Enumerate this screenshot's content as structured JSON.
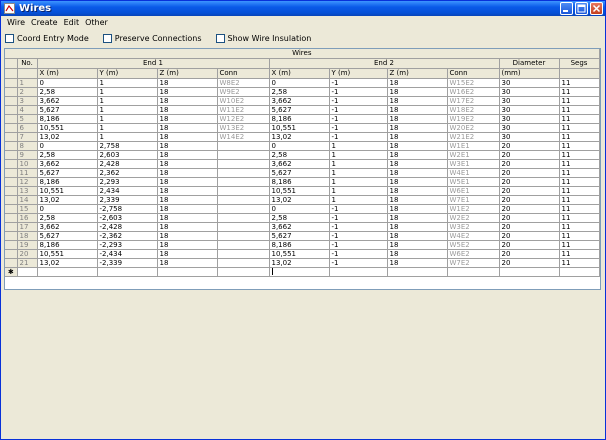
{
  "window": {
    "title": "Wires",
    "accent": "#0a5ae8"
  },
  "menu": [
    {
      "label": "Wire"
    },
    {
      "label": "Create"
    },
    {
      "label": "Edit"
    },
    {
      "label": "Other"
    }
  ],
  "options": [
    {
      "label": "Coord Entry Mode",
      "checked": false
    },
    {
      "label": "Preserve Connections",
      "checked": false
    },
    {
      "label": "Show Wire Insulation",
      "checked": false
    }
  ],
  "grid": {
    "caption": "Wires",
    "group_headers": {
      "no": "No.",
      "end1": "End 1",
      "end2": "End 2",
      "diameter": "Diameter",
      "segs": "Segs"
    },
    "columns": [
      "",
      "X  (m)",
      "Y  (m)",
      "Z  (m)",
      "Conn",
      "X  (m)",
      "Y  (m)",
      "Z  (m)",
      "Conn",
      "(mm)",
      ""
    ],
    "new_row_marker": "✱",
    "rows": [
      {
        "no": "1",
        "x1": "0",
        "y1": "1",
        "z1": "18",
        "c1": "W8E2",
        "x2": "0",
        "y2": "-1",
        "z2": "18",
        "c2": "W15E2",
        "d": "30",
        "s": "11"
      },
      {
        "no": "2",
        "x1": "2,58",
        "y1": "1",
        "z1": "18",
        "c1": "W9E2",
        "x2": "2,58",
        "y2": "-1",
        "z2": "18",
        "c2": "W16E2",
        "d": "30",
        "s": "11"
      },
      {
        "no": "3",
        "x1": "3,662",
        "y1": "1",
        "z1": "18",
        "c1": "W10E2",
        "x2": "3,662",
        "y2": "-1",
        "z2": "18",
        "c2": "W17E2",
        "d": "30",
        "s": "11"
      },
      {
        "no": "4",
        "x1": "5,627",
        "y1": "1",
        "z1": "18",
        "c1": "W11E2",
        "x2": "5,627",
        "y2": "-1",
        "z2": "18",
        "c2": "W18E2",
        "d": "30",
        "s": "11"
      },
      {
        "no": "5",
        "x1": "8,186",
        "y1": "1",
        "z1": "18",
        "c1": "W12E2",
        "x2": "8,186",
        "y2": "-1",
        "z2": "18",
        "c2": "W19E2",
        "d": "30",
        "s": "11"
      },
      {
        "no": "6",
        "x1": "10,551",
        "y1": "1",
        "z1": "18",
        "c1": "W13E2",
        "x2": "10,551",
        "y2": "-1",
        "z2": "18",
        "c2": "W20E2",
        "d": "30",
        "s": "11"
      },
      {
        "no": "7",
        "x1": "13,02",
        "y1": "1",
        "z1": "18",
        "c1": "W14E2",
        "x2": "13,02",
        "y2": "-1",
        "z2": "18",
        "c2": "W21E2",
        "d": "30",
        "s": "11"
      },
      {
        "no": "8",
        "x1": "0",
        "y1": "2,758",
        "z1": "18",
        "c1": "",
        "x2": "0",
        "y2": "1",
        "z2": "18",
        "c2": "W1E1",
        "d": "20",
        "s": "11"
      },
      {
        "no": "9",
        "x1": "2,58",
        "y1": "2,603",
        "z1": "18",
        "c1": "",
        "x2": "2,58",
        "y2": "1",
        "z2": "18",
        "c2": "W2E1",
        "d": "20",
        "s": "11"
      },
      {
        "no": "10",
        "x1": "3,662",
        "y1": "2,428",
        "z1": "18",
        "c1": "",
        "x2": "3,662",
        "y2": "1",
        "z2": "18",
        "c2": "W3E1",
        "d": "20",
        "s": "11"
      },
      {
        "no": "11",
        "x1": "5,627",
        "y1": "2,362",
        "z1": "18",
        "c1": "",
        "x2": "5,627",
        "y2": "1",
        "z2": "18",
        "c2": "W4E1",
        "d": "20",
        "s": "11"
      },
      {
        "no": "12",
        "x1": "8,186",
        "y1": "2,293",
        "z1": "18",
        "c1": "",
        "x2": "8,186",
        "y2": "1",
        "z2": "18",
        "c2": "W5E1",
        "d": "20",
        "s": "11"
      },
      {
        "no": "13",
        "x1": "10,551",
        "y1": "2,434",
        "z1": "18",
        "c1": "",
        "x2": "10,551",
        "y2": "1",
        "z2": "18",
        "c2": "W6E1",
        "d": "20",
        "s": "11"
      },
      {
        "no": "14",
        "x1": "13,02",
        "y1": "2,339",
        "z1": "18",
        "c1": "",
        "x2": "13,02",
        "y2": "1",
        "z2": "18",
        "c2": "W7E1",
        "d": "20",
        "s": "11"
      },
      {
        "no": "15",
        "x1": "0",
        "y1": "-2,758",
        "z1": "18",
        "c1": "",
        "x2": "0",
        "y2": "-1",
        "z2": "18",
        "c2": "W1E2",
        "d": "20",
        "s": "11"
      },
      {
        "no": "16",
        "x1": "2,58",
        "y1": "-2,603",
        "z1": "18",
        "c1": "",
        "x2": "2,58",
        "y2": "-1",
        "z2": "18",
        "c2": "W2E2",
        "d": "20",
        "s": "11"
      },
      {
        "no": "17",
        "x1": "3,662",
        "y1": "-2,428",
        "z1": "18",
        "c1": "",
        "x2": "3,662",
        "y2": "-1",
        "z2": "18",
        "c2": "W3E2",
        "d": "20",
        "s": "11"
      },
      {
        "no": "18",
        "x1": "5,627",
        "y1": "-2,362",
        "z1": "18",
        "c1": "",
        "x2": "5,627",
        "y2": "-1",
        "z2": "18",
        "c2": "W4E2",
        "d": "20",
        "s": "11"
      },
      {
        "no": "19",
        "x1": "8,186",
        "y1": "-2,293",
        "z1": "18",
        "c1": "",
        "x2": "8,186",
        "y2": "-1",
        "z2": "18",
        "c2": "W5E2",
        "d": "20",
        "s": "11"
      },
      {
        "no": "20",
        "x1": "10,551",
        "y1": "-2,434",
        "z1": "18",
        "c1": "",
        "x2": "10,551",
        "y2": "-1",
        "z2": "18",
        "c2": "W6E2",
        "d": "20",
        "s": "11"
      },
      {
        "no": "21",
        "x1": "13,02",
        "y1": "-2,339",
        "z1": "18",
        "c1": "",
        "x2": "13,02",
        "y2": "-1",
        "z2": "18",
        "c2": "W7E2",
        "d": "20",
        "s": "11"
      }
    ]
  }
}
